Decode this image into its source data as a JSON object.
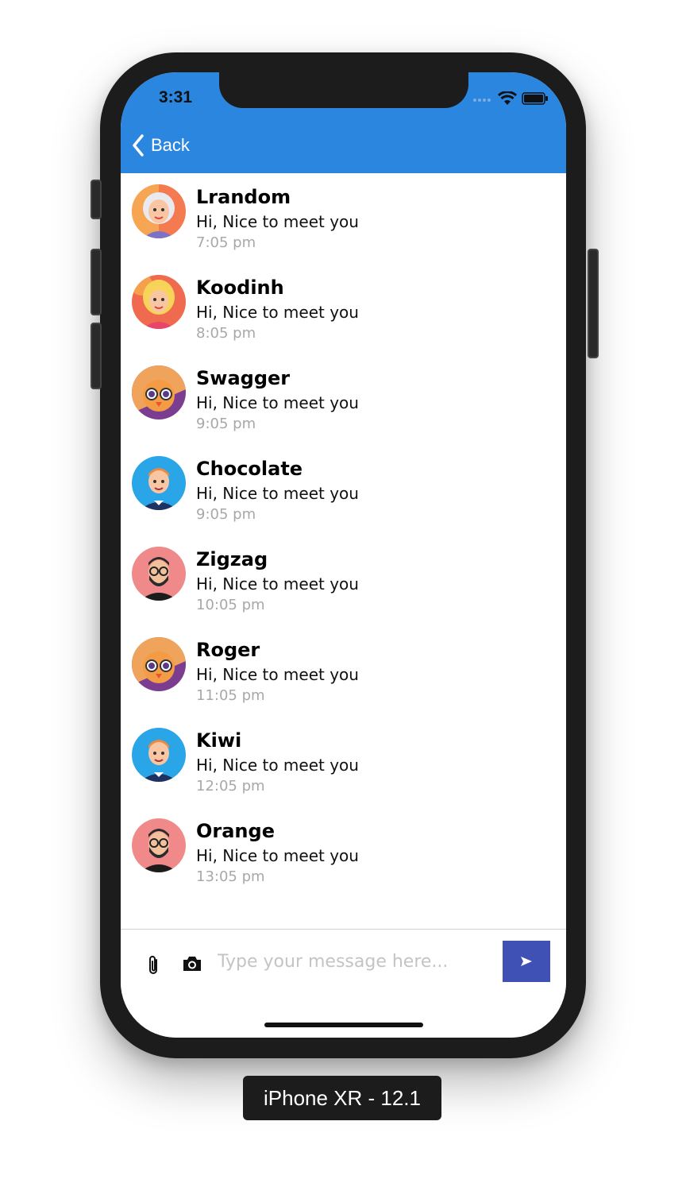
{
  "status_bar": {
    "time": "3:31"
  },
  "header": {
    "back_label": "Back",
    "color": "#2b86e0"
  },
  "conversations": [
    {
      "name": "Lrandom",
      "message": "Hi, Nice to meet you",
      "time": "7:05 pm",
      "avatar": "woman-grey-hair-avatar"
    },
    {
      "name": "Koodinh",
      "message": "Hi, Nice to meet you",
      "time": "8:05 pm",
      "avatar": "woman-blonde-avatar"
    },
    {
      "name": "Swagger",
      "message": "Hi, Nice to meet you",
      "time": "9:05 pm",
      "avatar": "bird-sunglasses-avatar"
    },
    {
      "name": "Chocolate",
      "message": "Hi, Nice to meet you",
      "time": "9:05 pm",
      "avatar": "man-blue-bg-avatar"
    },
    {
      "name": "Zigzag",
      "message": "Hi, Nice to meet you",
      "time": "10:05 pm",
      "avatar": "man-glasses-beard-avatar"
    },
    {
      "name": "Roger",
      "message": "Hi, Nice to meet you",
      "time": "11:05 pm",
      "avatar": "bird-sunglasses-avatar"
    },
    {
      "name": "Kiwi",
      "message": "Hi, Nice to meet you",
      "time": "12:05 pm",
      "avatar": "man-blue-bg-avatar"
    },
    {
      "name": "Orange",
      "message": "Hi, Nice to meet you",
      "time": "13:05 pm",
      "avatar": "man-glasses-beard-avatar"
    }
  ],
  "composer": {
    "placeholder": "Type your message here...",
    "send_color": "#3f51b5"
  },
  "device_label": "iPhone XR - 12.1"
}
